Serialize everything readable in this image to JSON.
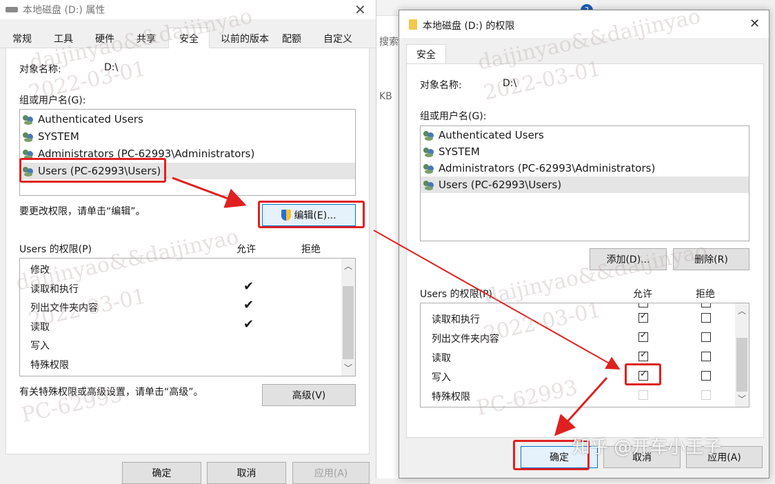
{
  "left_dialog": {
    "title": "本地磁盘 (D:) 属性",
    "tabs": [
      "常规",
      "工具",
      "硬件",
      "共享",
      "安全",
      "以前的版本",
      "配额",
      "自定义"
    ],
    "object_label": "对象名称:",
    "object_value": "D:\\",
    "group_label": "组或用户名(G):",
    "users": [
      "Authenticated Users",
      "SYSTEM",
      "Administrators (PC-62993\\Administrators)",
      "Users (PC-62993\\Users)"
    ],
    "edit_hint": "要更改权限，请单击“编辑”。",
    "edit_button": "编辑(E)...",
    "perm_header": "Users 的权限(P)",
    "allow_header": "允许",
    "deny_header": "拒绝",
    "permissions": [
      {
        "name": "修改",
        "allow": false
      },
      {
        "name": "读取和执行",
        "allow": true
      },
      {
        "name": "列出文件夹内容",
        "allow": true
      },
      {
        "name": "读取",
        "allow": true
      },
      {
        "name": "写入",
        "allow": false
      },
      {
        "name": "特殊权限",
        "allow": false
      }
    ],
    "advanced_hint": "有关特殊权限或高级设置，请单击“高级”。",
    "advanced_button": "高级(V)",
    "ok_button": "确定",
    "cancel_button": "取消",
    "apply_button": "应用(A)"
  },
  "middle_strip": {
    "search_label": "搜索",
    "kb_label": "KB",
    "badge": "?"
  },
  "right_dialog": {
    "title": "本地磁盘 (D:) 的权限",
    "tab": "安全",
    "object_label": "对象名称:",
    "object_value": "D:\\",
    "group_label": "组或用户名(G):",
    "users": [
      "Authenticated Users",
      "SYSTEM",
      "Administrators (PC-62993\\Administrators)",
      "Users (PC-62993\\Users)"
    ],
    "add_button": "添加(D)...",
    "remove_button": "删除(R)",
    "perm_header": "Users 的权限(P)",
    "allow_header": "允许",
    "deny_header": "拒绝",
    "permissions": [
      {
        "name": "读取和执行",
        "allow": true,
        "deny": false
      },
      {
        "name": "列出文件夹内容",
        "allow": true,
        "deny": false
      },
      {
        "name": "读取",
        "allow": true,
        "deny": false
      },
      {
        "name": "写入",
        "allow": true,
        "deny": false
      },
      {
        "name": "特殊权限",
        "allow": false,
        "deny": false
      }
    ],
    "ok_button": "确定",
    "cancel_button": "取消",
    "apply_button": "应用(A)"
  },
  "watermark": {
    "author": "daijinyao&&daijinyao",
    "date": "2022-03-01",
    "pc": "PC-62993",
    "zhihu": "知乎 @开车小王子"
  },
  "annotation_color": "#e02020"
}
